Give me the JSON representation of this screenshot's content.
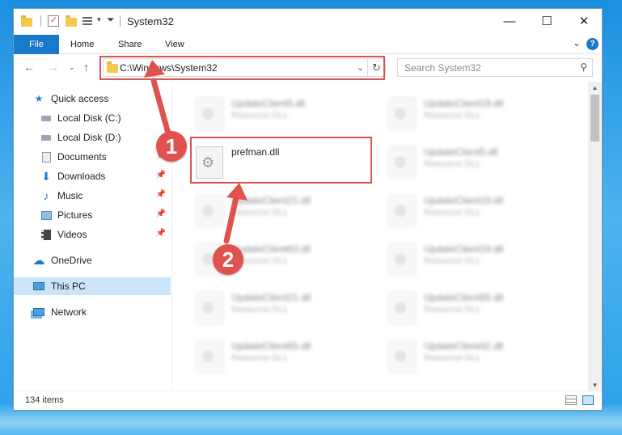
{
  "window": {
    "title": "System32",
    "controls": {
      "minimize": "—",
      "maximize": "☐",
      "close": "✕"
    }
  },
  "ribbon": {
    "tabs": [
      "File",
      "Home",
      "Share",
      "View"
    ],
    "help": "?"
  },
  "nav": {
    "address": "C:\\Windows\\System32",
    "search_placeholder": "Search System32"
  },
  "sidebar": {
    "items": [
      {
        "label": "Quick access",
        "icon": "star-icon"
      },
      {
        "label": "Local Disk (C:)",
        "icon": "drive-icon"
      },
      {
        "label": "Local Disk (D:)",
        "icon": "drive-icon"
      },
      {
        "label": "Documents",
        "icon": "documents-icon"
      },
      {
        "label": "Downloads",
        "icon": "download-arrow-icon"
      },
      {
        "label": "Music",
        "icon": "music-note-icon"
      },
      {
        "label": "Pictures",
        "icon": "pictures-icon"
      },
      {
        "label": "Videos",
        "icon": "videos-icon"
      },
      {
        "label": "OneDrive",
        "icon": "cloud-icon"
      },
      {
        "label": "This PC",
        "icon": "computer-icon"
      },
      {
        "label": "Network",
        "icon": "network-icon"
      }
    ]
  },
  "files": {
    "left_column": [
      {
        "name": "UpdateClient5.dll",
        "type": "Resource DLL"
      },
      {
        "name": "prefman.dll",
        "type": ""
      },
      {
        "name": "UpdateClient21.dll",
        "type": "Resource DLL"
      },
      {
        "name": "UpdateClient63.dll",
        "type": "Resource DLL"
      },
      {
        "name": "UpdateClient21.dll",
        "type": "Resource DLL"
      },
      {
        "name": "UpdateClient65.dll",
        "type": "Resource DLL"
      }
    ],
    "right_column": [
      {
        "name": "UpdateClient19.dll",
        "type": "Resource DLL"
      },
      {
        "name": "UpdateClient5.dll",
        "type": "Resource DLL"
      },
      {
        "name": "UpdateClient19.dll",
        "type": "Resource DLL"
      },
      {
        "name": "UpdateClient19.dll",
        "type": "Resource DLL"
      },
      {
        "name": "UpdateClient65.dll",
        "type": "Resource DLL"
      },
      {
        "name": "UpdateClient42.dll",
        "type": "Resource DLL"
      }
    ]
  },
  "status": {
    "item_count": "134 items"
  },
  "annotations": {
    "step1": "1",
    "step2": "2",
    "color": "#e0524e"
  }
}
